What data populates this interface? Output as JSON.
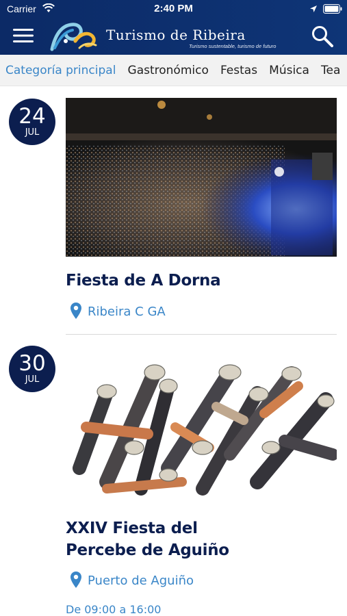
{
  "status_bar": {
    "carrier": "Carrier",
    "time": "2:40 PM",
    "icons": [
      "wifi-icon",
      "location-icon",
      "battery-icon"
    ]
  },
  "header": {
    "title": "Turismo de Ribeira",
    "tagline": "Turismo sustentable, turismo de futuro",
    "menu_icon": "menu-icon",
    "search_icon": "search-icon"
  },
  "colors": {
    "header_bg": "#0c2a66",
    "badge_bg": "#0c1e4f",
    "accent": "#3a86c8",
    "title_text": "#0c1e4f"
  },
  "tabs": [
    {
      "label": "Categoría principal",
      "active": true
    },
    {
      "label": "Gastronómico",
      "active": false
    },
    {
      "label": "Festas",
      "active": false
    },
    {
      "label": "Música",
      "active": false
    },
    {
      "label": "Tea",
      "active": false
    }
  ],
  "events": [
    {
      "day": "24",
      "month": "JUL",
      "title": "Fiesta de A Dorna",
      "place": "Ribeira C GA",
      "photo": "night concert crowd aerial photo"
    },
    {
      "day": "30",
      "month": "JUL",
      "title": "XXIV Fiesta del Percebe de Aguiño",
      "place": "Puerto de Aguiño",
      "hours": "De 09:00 a 16:00",
      "photo": "goose barnacles (percebes) photo"
    }
  ]
}
